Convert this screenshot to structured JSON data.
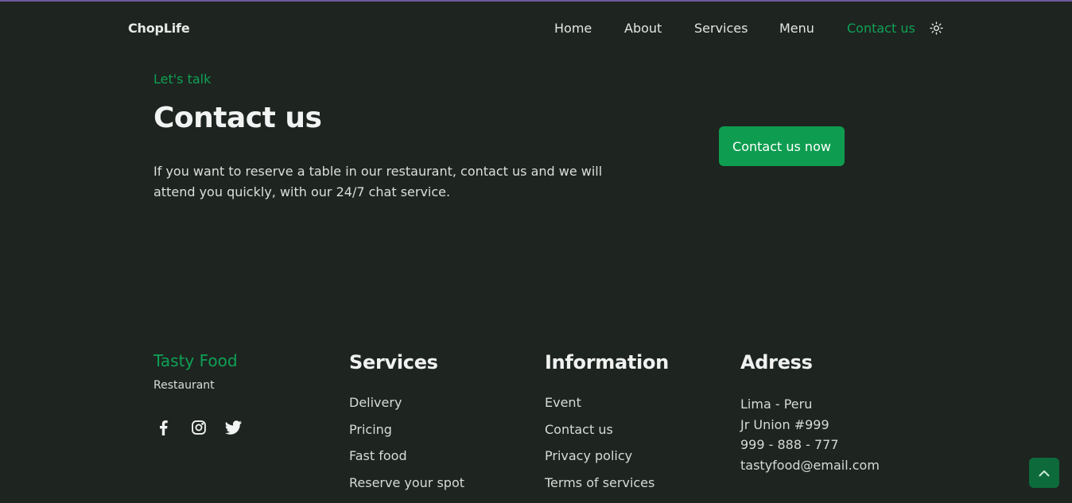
{
  "header": {
    "brand": "ChopLife",
    "nav": [
      "Home",
      "About",
      "Services",
      "Menu",
      "Contact us"
    ],
    "active": "Contact us",
    "theme_icon": "sun-icon"
  },
  "contact": {
    "eyebrow": "Let's talk",
    "title": "Contact us",
    "description": "If you want to reserve a table in our restaurant, contact us and we will attend you quickly, with our 24/7 chat service.",
    "cta_label": "Contact us now"
  },
  "footer": {
    "brand": "Tasty Food",
    "subtitle": "Restaurant",
    "socials": [
      "facebook-icon",
      "instagram-icon",
      "twitter-icon"
    ],
    "services": {
      "title": "Services",
      "links": [
        "Delivery",
        "Pricing",
        "Fast food",
        "Reserve your spot"
      ]
    },
    "information": {
      "title": "Information",
      "links": [
        "Event",
        "Contact us",
        "Privacy policy",
        "Terms of services"
      ]
    },
    "address": {
      "title": "Adress",
      "lines": [
        "Lima - Peru",
        "Jr Union #999",
        "999 - 888 - 777",
        "tastyfood@email.com"
      ]
    }
  },
  "colors": {
    "background": "#1e2420",
    "accent": "#0fa155",
    "button": "#0e9d50",
    "scroll_button": "#0d6b3b"
  },
  "scroll_top_icon": "chevron-up-icon"
}
